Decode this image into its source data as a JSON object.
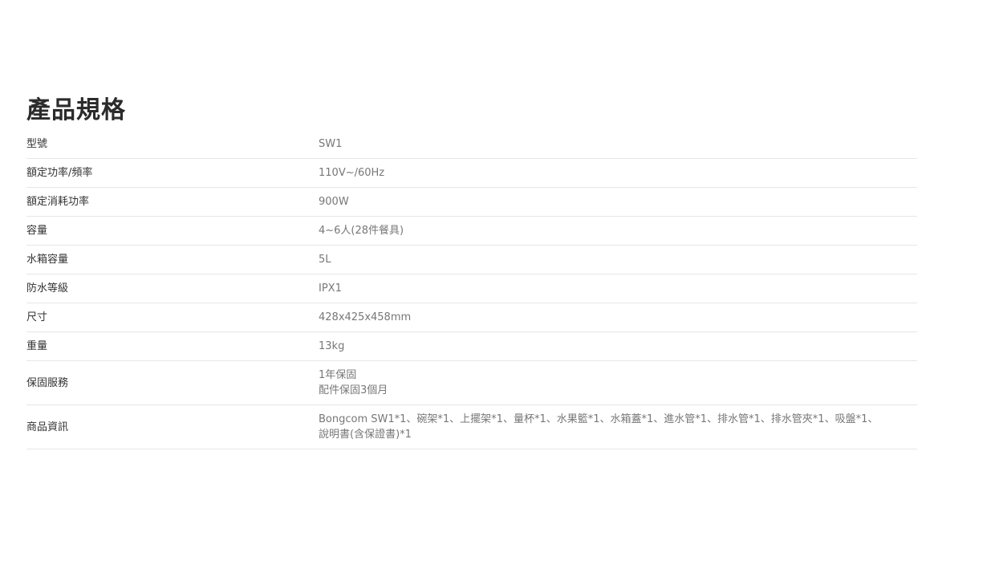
{
  "page": {
    "title": "產品規格"
  },
  "specs": [
    {
      "label": "型號",
      "values": [
        "SW1"
      ]
    },
    {
      "label": "額定功率/頻率",
      "values": [
        "110V~/60Hz"
      ]
    },
    {
      "label": "額定消耗功率",
      "values": [
        "900W"
      ]
    },
    {
      "label": "容量",
      "values": [
        "4~6人(28件餐具)"
      ]
    },
    {
      "label": "水箱容量",
      "values": [
        "5L"
      ]
    },
    {
      "label": "防水等級",
      "values": [
        "IPX1"
      ]
    },
    {
      "label": "尺寸",
      "values": [
        "428x425x458mm"
      ]
    },
    {
      "label": "重量",
      "values": [
        "13kg"
      ]
    },
    {
      "label": "保固服務",
      "values": [
        "1年保固",
        "配件保固3個月"
      ]
    },
    {
      "label": "商品資訊",
      "values": [
        "Bongcom SW1*1、碗架*1、上擺架*1、量杯*1、水果籃*1、水箱蓋*1、進水管*1、排水管*1、排水管夾*1、吸盤*1、",
        "說明書(含保證書)*1"
      ]
    }
  ]
}
